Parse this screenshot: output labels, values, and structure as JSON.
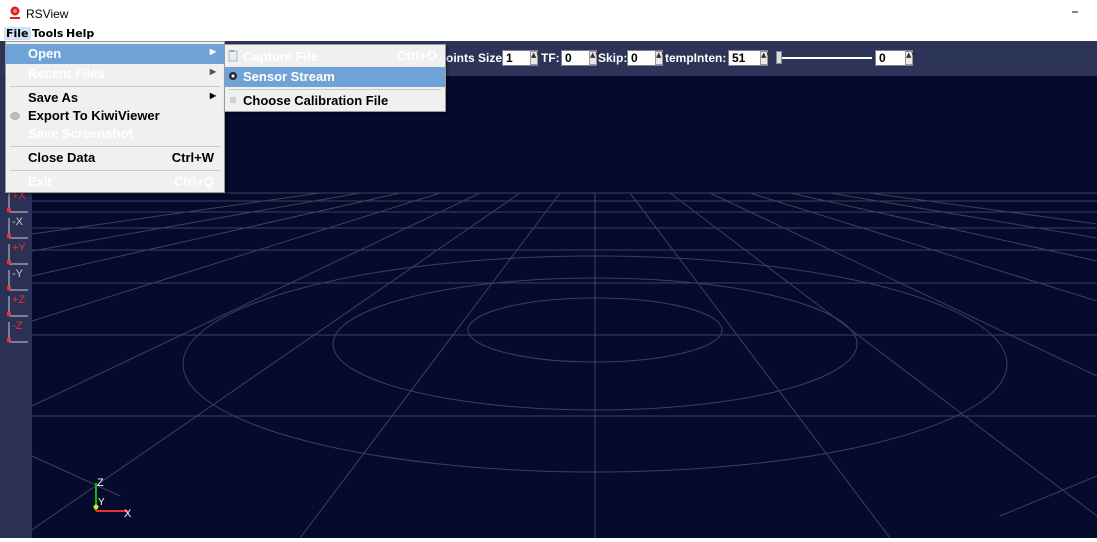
{
  "window": {
    "title": "RSView",
    "minimize_glyph": "–"
  },
  "menubar": {
    "file": "File",
    "tools": "Tools",
    "help": "Help"
  },
  "toolbar": {
    "points_size_label": "oints Size:",
    "points_size_value": "1",
    "tf_label": "TF:",
    "tf_value": "0",
    "skip_label": "Skip:",
    "skip_value": "0",
    "tempinten_label": "tempInten:",
    "tempinten_value": "51",
    "slider_value": "0"
  },
  "file_menu": {
    "open": "Open",
    "recent_files": "Recent Files",
    "save_as": "Save As",
    "export_kiwi": "Export To KiwiViewer",
    "save_screenshot": "Save Screenshot",
    "close_data": "Close Data",
    "close_data_shortcut": "Ctrl+W",
    "exit": "Exit",
    "exit_shortcut": "Ctrl+Q"
  },
  "open_submenu": {
    "capture_file": "Capture File",
    "capture_file_shortcut": "Ctrl+O",
    "sensor_stream": "Sensor Stream",
    "choose_calibration": "Choose Calibration File"
  },
  "axis_buttons": [
    "+X",
    "-X",
    "+Y",
    "-Y",
    "+Z",
    "-Z"
  ],
  "orientation_axes": {
    "z": "Z",
    "y": "Y",
    "x": "X"
  },
  "colors": {
    "toolbar_bg": "#2c3558",
    "viewport_bg": "#060b2e",
    "menu_highlight": "#6fa3d8",
    "axis_red": "#e83030"
  },
  "icons": [
    "app-logo-icon",
    "capture-file-icon",
    "sensor-stream-icon",
    "calibration-icon",
    "export-icon"
  ]
}
